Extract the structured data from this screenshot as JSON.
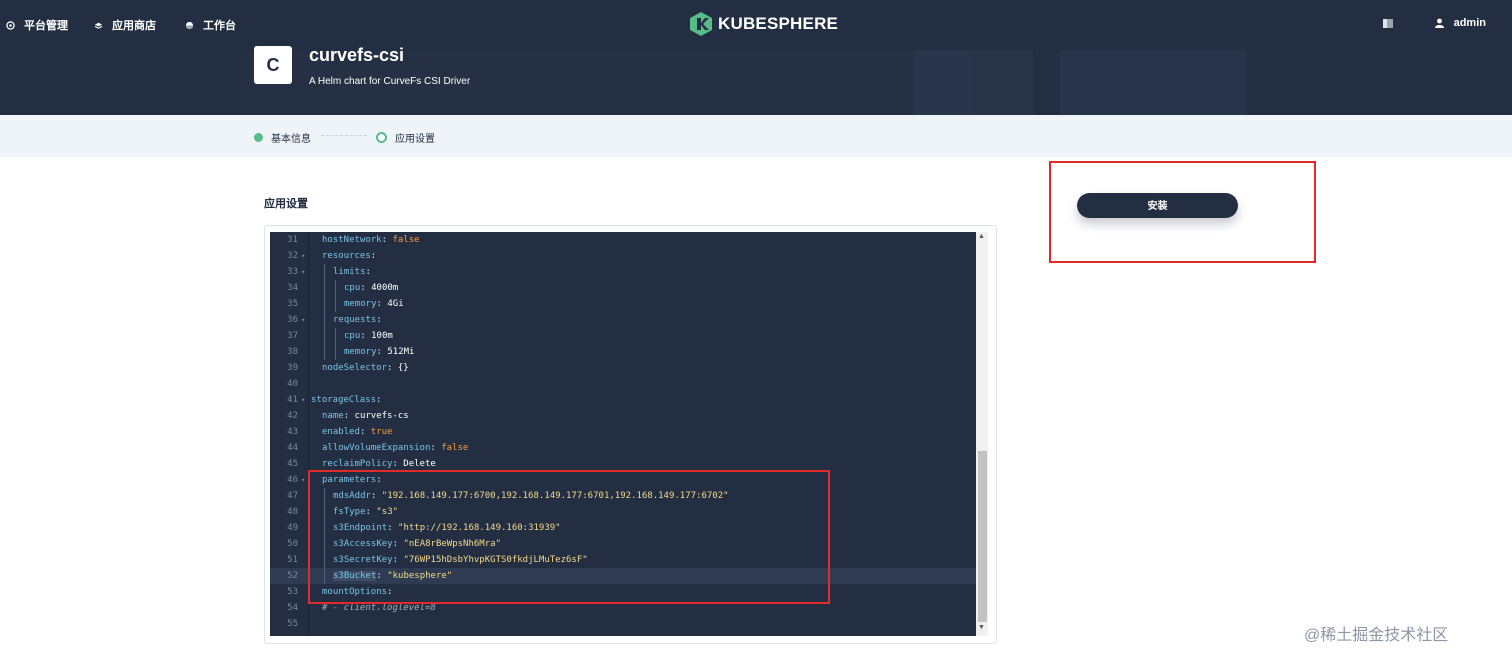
{
  "nav": {
    "items": [
      {
        "label": "平台管理",
        "icon": "platform-icon"
      },
      {
        "label": "应用商店",
        "icon": "appstore-icon"
      },
      {
        "label": "工作台",
        "icon": "workbench-icon"
      }
    ],
    "logo_text": "KUBESPHERE",
    "user": "admin"
  },
  "app": {
    "icon_letter": "C",
    "name": "curvefs-csi",
    "description": "A Helm chart for CurveFs CSI Driver"
  },
  "steps": [
    {
      "label": "基本信息",
      "state": "done"
    },
    {
      "label": "应用设置",
      "state": "current"
    }
  ],
  "section_title": "应用设置",
  "install_label": "安装",
  "watermark": "@稀土掘金技术社区",
  "editor": {
    "active_line": 52,
    "lines": [
      {
        "n": "31",
        "fold": false,
        "indent": 1,
        "key": "hostNetwork",
        "val": "false",
        "t": "b"
      },
      {
        "n": "32",
        "fold": true,
        "indent": 1,
        "key": "resources",
        "val": "",
        "t": ""
      },
      {
        "n": "33",
        "fold": true,
        "indent": 2,
        "key": "limits",
        "val": "",
        "t": ""
      },
      {
        "n": "34",
        "fold": false,
        "indent": 3,
        "key": "cpu",
        "val": "4000m",
        "t": "n"
      },
      {
        "n": "35",
        "fold": false,
        "indent": 3,
        "key": "memory",
        "val": "4Gi",
        "t": "n"
      },
      {
        "n": "36",
        "fold": true,
        "indent": 2,
        "key": "requests",
        "val": "",
        "t": ""
      },
      {
        "n": "37",
        "fold": false,
        "indent": 3,
        "key": "cpu",
        "val": "100m",
        "t": "n"
      },
      {
        "n": "38",
        "fold": false,
        "indent": 3,
        "key": "memory",
        "val": "512Mi",
        "t": "n"
      },
      {
        "n": "39",
        "fold": false,
        "indent": 1,
        "key": "nodeSelector",
        "val": "{}",
        "t": "n"
      },
      {
        "n": "40",
        "fold": false,
        "indent": 0,
        "key": "",
        "val": "",
        "t": ""
      },
      {
        "n": "41",
        "fold": true,
        "indent": 0,
        "key": "storageClass",
        "val": "",
        "t": ""
      },
      {
        "n": "42",
        "fold": false,
        "indent": 1,
        "key": "name",
        "val": "curvefs-cs",
        "t": "n"
      },
      {
        "n": "43",
        "fold": false,
        "indent": 1,
        "key": "enabled",
        "val": "true",
        "t": "b"
      },
      {
        "n": "44",
        "fold": false,
        "indent": 1,
        "key": "allowVolumeExpansion",
        "val": "false",
        "t": "b"
      },
      {
        "n": "45",
        "fold": false,
        "indent": 1,
        "key": "reclaimPolicy",
        "val": "Delete",
        "t": "n"
      },
      {
        "n": "46",
        "fold": true,
        "indent": 1,
        "key": "parameters",
        "val": "",
        "t": ""
      },
      {
        "n": "47",
        "fold": false,
        "indent": 2,
        "key": "mdsAddr",
        "val": "\"192.168.149.177:6700,192.168.149.177:6701,192.168.149.177:6702\"",
        "t": "s"
      },
      {
        "n": "48",
        "fold": false,
        "indent": 2,
        "key": "fsType",
        "val": "\"s3\"",
        "t": "s"
      },
      {
        "n": "49",
        "fold": false,
        "indent": 2,
        "key": "s3Endpoint",
        "val": "\"http://192.168.149.160:31939\"",
        "t": "s"
      },
      {
        "n": "50",
        "fold": false,
        "indent": 2,
        "key": "s3AccessKey",
        "val": "\"nEA8rBeWpsNh6Mra\"",
        "t": "s"
      },
      {
        "n": "51",
        "fold": false,
        "indent": 2,
        "key": "s3SecretKey",
        "val": "\"76WP15hDsbYhvpKGTS0fkdjLMuTez6sF\"",
        "t": "s"
      },
      {
        "n": "52",
        "fold": false,
        "indent": 2,
        "key": "s3Bucket",
        "val": "\"kubesphere\"",
        "t": "s"
      },
      {
        "n": "53",
        "fold": false,
        "indent": 1,
        "key": "mountOptions",
        "val": "",
        "t": ""
      },
      {
        "n": "54",
        "fold": false,
        "indent": 1,
        "key": "",
        "val": "# - client.loglevel=8",
        "t": "c"
      },
      {
        "n": "55",
        "fold": false,
        "indent": 0,
        "key": "",
        "val": "",
        "t": ""
      }
    ]
  },
  "colors": {
    "dark": "#242e42",
    "success": "#55bc8a",
    "highlight_box": "#e22a2a"
  }
}
